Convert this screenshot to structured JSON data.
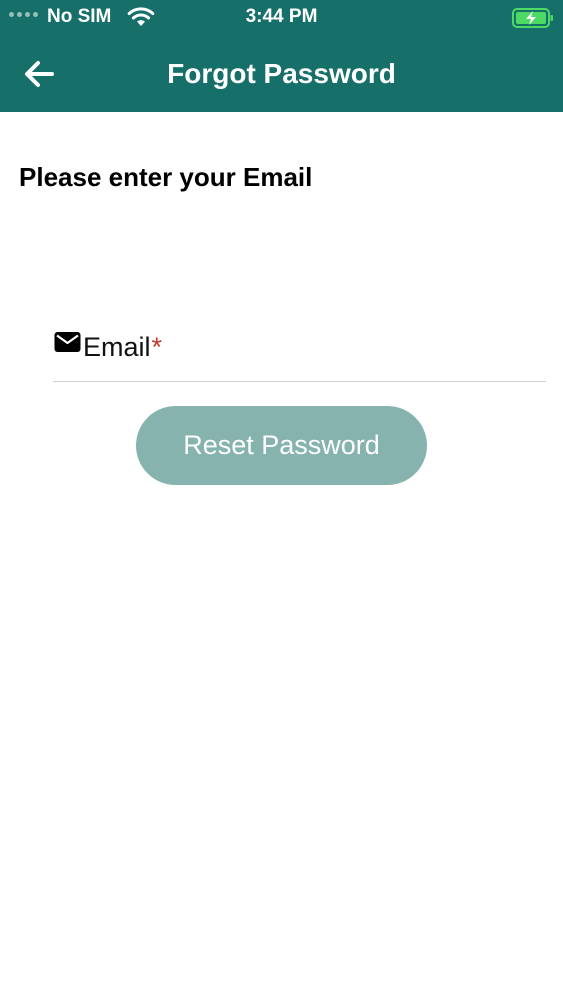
{
  "status_bar": {
    "carrier": "No SIM",
    "time": "3:44 PM",
    "wifi_icon": "wifi-icon",
    "battery_icon": "battery-charging-icon",
    "battery_color": "#4cd964"
  },
  "nav": {
    "title": "Forgot Password",
    "back_icon": "back-arrow-icon"
  },
  "form": {
    "prompt": "Please enter your Email",
    "email_label": "Email",
    "required_mark": "*",
    "email_value": "",
    "email_icon": "mail-icon",
    "submit_label": "Reset Password"
  },
  "colors": {
    "header_bg": "#176f6a",
    "button_bg": "#86b3ae",
    "required": "#c0392b"
  }
}
